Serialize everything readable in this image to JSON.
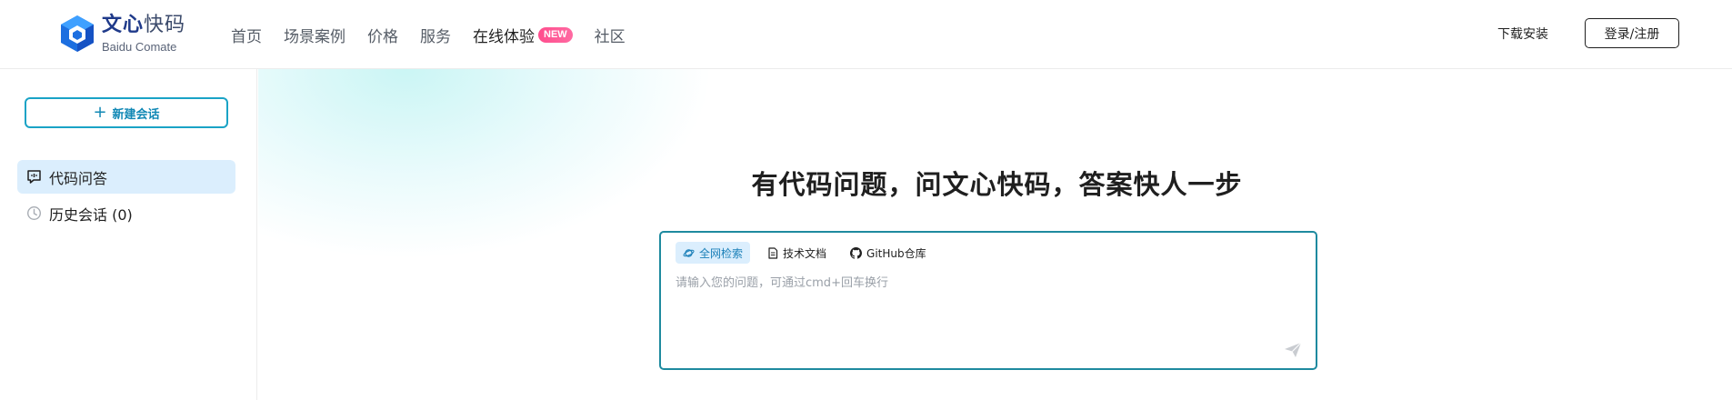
{
  "header": {
    "logo": {
      "title_bold": "文心",
      "title_light": "快码",
      "subtitle": "Baidu Comate"
    },
    "nav": [
      {
        "label": "首页",
        "active": false
      },
      {
        "label": "场景案例",
        "active": false
      },
      {
        "label": "价格",
        "active": false
      },
      {
        "label": "服务",
        "active": false
      },
      {
        "label": "在线体验",
        "active": true,
        "badge": "NEW"
      },
      {
        "label": "社区",
        "active": false
      }
    ],
    "download_label": "下载安装",
    "login_label": "登录/注册"
  },
  "sidebar": {
    "new_chat_label": "新建会话",
    "items": [
      {
        "label": "代码问答",
        "icon": "chat-code-icon",
        "active": true
      },
      {
        "label": "历史会话 (0)",
        "icon": "clock-icon",
        "active": false
      }
    ]
  },
  "main": {
    "headline": "有代码问题，问文心快码，答案快人一步",
    "tabs": [
      {
        "label": "全网检索",
        "icon": "planet-icon",
        "active": true
      },
      {
        "label": "技术文档",
        "icon": "document-icon",
        "active": false
      },
      {
        "label": "GitHub仓库",
        "icon": "github-icon",
        "active": false
      }
    ],
    "input_placeholder": "请输入您的问题，可通过cmd+回车换行"
  },
  "colors": {
    "accent": "#1aa3c6",
    "input_border": "#1e8a9f",
    "active_bg": "#dbeefd",
    "badge": "#ff4d8d"
  }
}
